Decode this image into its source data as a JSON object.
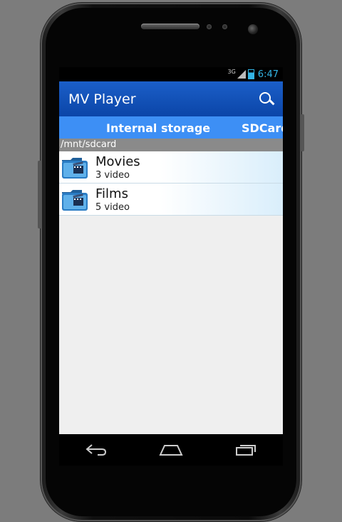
{
  "status_bar": {
    "network": "3G",
    "time": "6:47"
  },
  "app_bar": {
    "title": "MV Player",
    "search_icon": "search-icon"
  },
  "tabs": [
    {
      "label": "Internal storage"
    },
    {
      "label": "SDCard"
    }
  ],
  "path": "/mnt/sdcard",
  "items": [
    {
      "name": "Movies",
      "count": "3 video",
      "icon": "video-folder-icon"
    },
    {
      "name": "Films",
      "count": "5 video",
      "icon": "video-folder-icon"
    }
  ],
  "nav_buttons": [
    "back-icon",
    "home-icon",
    "recent-apps-icon"
  ],
  "colors": {
    "app_bar": "#1b5fc8",
    "tab_bar": "#3d8ff5",
    "status_accent": "#33b5e5"
  }
}
